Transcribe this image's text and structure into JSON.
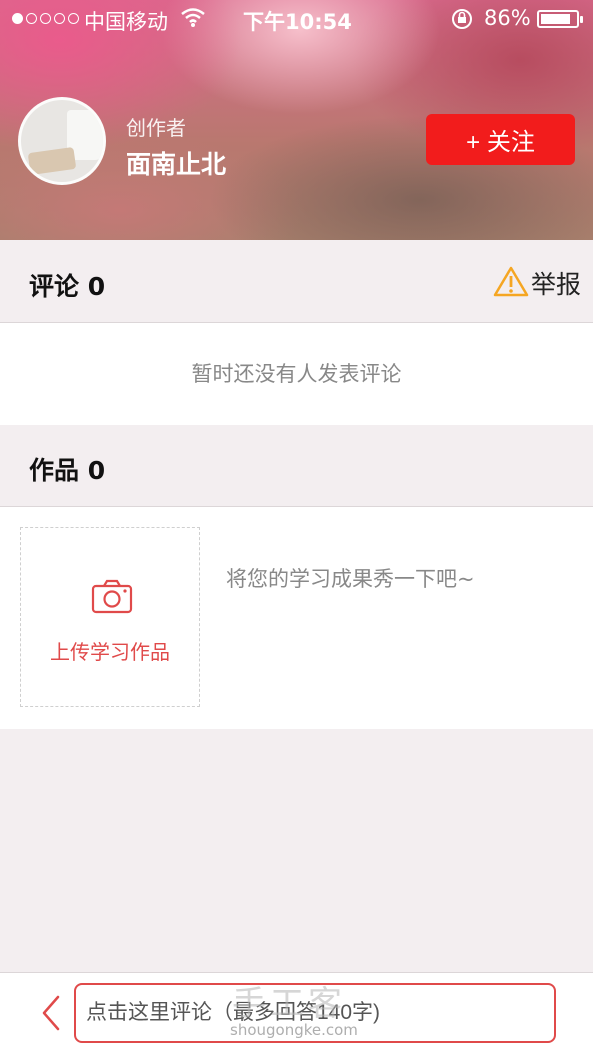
{
  "status_bar": {
    "carrier": "中国移动",
    "time": "下午10:54",
    "battery_pct": "86%",
    "battery_level": 0.86,
    "signal_bars_filled": 1,
    "signal_bars_total": 5
  },
  "header": {
    "role_label": "创作者",
    "author_name": "面南止北",
    "follow_label": "+ 关注"
  },
  "comments": {
    "title": "评论 0",
    "report_label": "举报",
    "empty_text": "暂时还没有人发表评论"
  },
  "works": {
    "title": "作品 0",
    "upload_label": "上传学习作品",
    "hint": "将您的学习成果秀一下吧~"
  },
  "bottom_bar": {
    "comment_placeholder": "点击这里评论（最多回答140字)",
    "watermark": "手工客",
    "watermark_sub": "shougongke.com"
  },
  "colors": {
    "accent": "#f21c1c",
    "accent_soft": "#e04a4a",
    "warning": "#f5a623",
    "page_bg": "#f3eef0"
  },
  "icons": {
    "wifi": "wifi-icon",
    "lock": "orientation-lock-icon",
    "battery": "battery-icon",
    "warning": "warning-triangle-icon",
    "camera": "camera-icon",
    "back": "chevron-left-icon"
  }
}
